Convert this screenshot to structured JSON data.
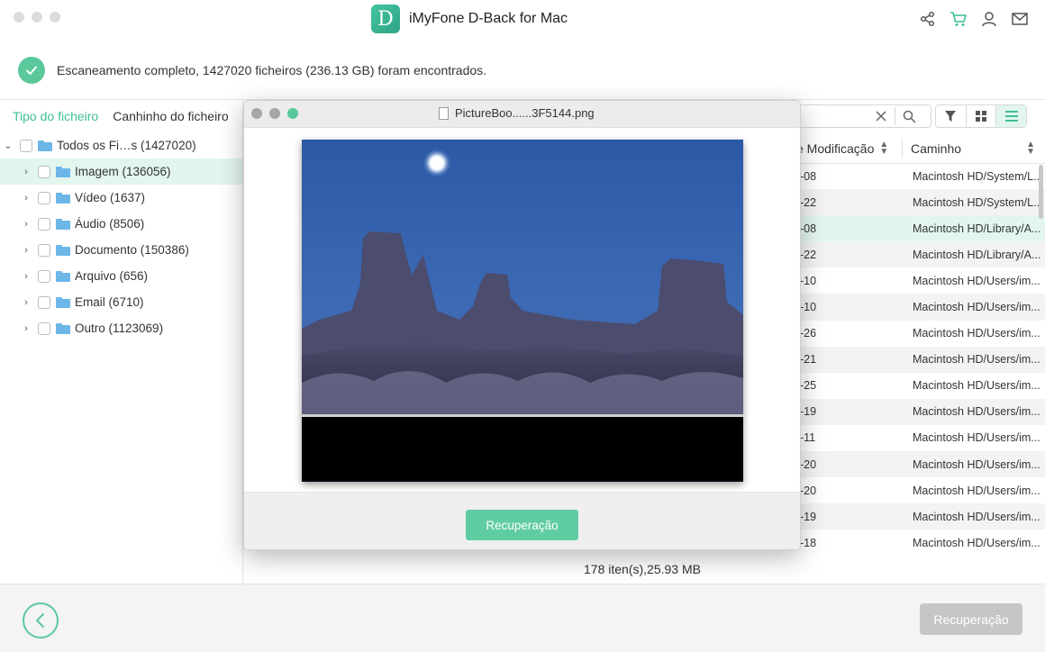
{
  "app": {
    "title": "iMyFone D-Back for Mac",
    "logo_letter": "D"
  },
  "window_controls": [
    "close",
    "minimize",
    "zoom"
  ],
  "toolbar_icons": [
    "share-icon",
    "cart-icon",
    "user-icon",
    "mail-icon"
  ],
  "status": {
    "message": "Escaneamento completo, 1427020 ficheiros (236.13 GB) foram encontrados."
  },
  "sidebar": {
    "tabs": [
      {
        "label": "Tipo do ficheiro",
        "active": true
      },
      {
        "label": "Canhinho do ficheiro",
        "active": false
      }
    ],
    "root": {
      "label": "Todos os Fi…s (1427020)"
    },
    "items": [
      {
        "label": "Imagem (136056)",
        "selected": true
      },
      {
        "label": "Vídeo (1637)",
        "selected": false
      },
      {
        "label": "Áudio (8506)",
        "selected": false
      },
      {
        "label": "Documento (150386)",
        "selected": false
      },
      {
        "label": "Arquivo (656)",
        "selected": false
      },
      {
        "label": "Email (6710)",
        "selected": false
      },
      {
        "label": "Outro (1123069)",
        "selected": false
      }
    ]
  },
  "table": {
    "headers": {
      "modified": "e Modificação",
      "path": "Caminho"
    },
    "rows": [
      {
        "date": "-08",
        "path": "Macintosh HD/System/L..."
      },
      {
        "date": "-22",
        "path": "Macintosh HD/System/L..."
      },
      {
        "date": "-08",
        "path": "Macintosh HD/Library/A...",
        "highlight": true
      },
      {
        "date": "-22",
        "path": "Macintosh HD/Library/A..."
      },
      {
        "date": "-10",
        "path": "Macintosh HD/Users/im..."
      },
      {
        "date": "-10",
        "path": "Macintosh HD/Users/im..."
      },
      {
        "date": "-26",
        "path": "Macintosh HD/Users/im..."
      },
      {
        "date": "-21",
        "path": "Macintosh HD/Users/im..."
      },
      {
        "date": "-25",
        "path": "Macintosh HD/Users/im..."
      },
      {
        "date": "-19",
        "path": "Macintosh HD/Users/im..."
      },
      {
        "date": "-11",
        "path": "Macintosh HD/Users/im..."
      },
      {
        "date": "-20",
        "path": "Macintosh HD/Users/im..."
      },
      {
        "date": "-20",
        "path": "Macintosh HD/Users/im..."
      },
      {
        "date": "-19",
        "path": "Macintosh HD/Users/im..."
      },
      {
        "date": "-18",
        "path": "Macintosh HD/Users/im..."
      }
    ],
    "footer": "178 iten(s),25.93 MB"
  },
  "preview": {
    "filename": "PictureBoo......3F5144.png",
    "recover_label": "Recuperação"
  },
  "bottom": {
    "recover_label": "Recuperação"
  },
  "colors": {
    "accent": "#5ac89b",
    "selected_bg": "#e3f6ee",
    "disabled_button": "#c6c6c6"
  }
}
